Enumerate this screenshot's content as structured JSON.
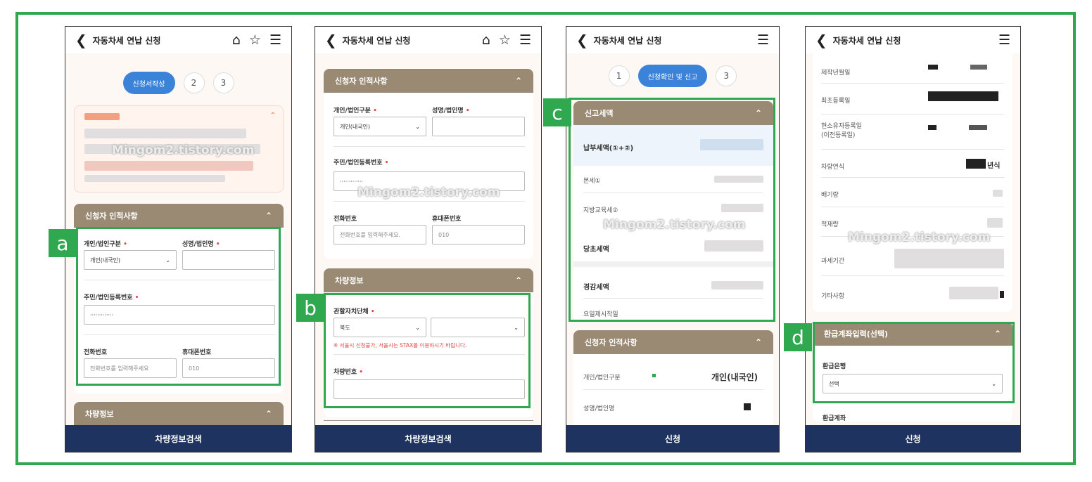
{
  "screens": [
    {
      "header_title": "자동차세 연납 신청",
      "steps": [
        "신청서작성",
        "2",
        "3"
      ],
      "section_applicant": "신청자 인적사항",
      "label_type": "개인/법인구분",
      "label_name": "성명/법인명",
      "select_type_value": "개인(내국인)",
      "label_regno": "주민/법인등록번호",
      "regno_value": "·············",
      "label_phone": "전화번호",
      "phone_placeholder": "전화번호를 입력해주세요",
      "label_mobile": "휴대폰번호",
      "mobile_value": "010",
      "section_vehicle": "차량정보",
      "bottom_button": "차량정보검색",
      "tag": "a"
    },
    {
      "header_title": "자동차세 연납 신청",
      "section_applicant": "신청자 인적사항",
      "label_type": "개인/법인구분",
      "label_name": "성명/법인명",
      "select_type_value": "개인(내국인)",
      "label_regno": "주민/법인등록번호",
      "regno_value": "·············",
      "label_phone": "전화번호",
      "phone_placeholder": "전화번호를 입력해주세요.",
      "label_mobile": "휴대폰번호",
      "mobile_value": "010",
      "section_vehicle": "차량정보",
      "label_region": "관할자치단체",
      "region_value": "북도",
      "region_warning": "※ 서울시 신청불가, 서울시는 STAX를 이용하시기 바랍니다.",
      "label_carno": "차량번호",
      "bottom_button": "차량정보검색",
      "tag": "b"
    },
    {
      "header_title": "자동차세 연납 신청",
      "steps": [
        "1",
        "신청확인 및 신고",
        "3"
      ],
      "section_tax": "신고세액",
      "tax_total": "납부세액(①+②)",
      "tax_main": "본세①",
      "tax_edu": "지방교육세②",
      "tax_initial": "당초세액",
      "tax_reduced": "경감세액",
      "tax_date": "요일제시작일",
      "section_applicant": "신청자 인적사항",
      "label_type": "개인/법인구분",
      "type_value": "개인(내국인)",
      "label_name": "성명/법인명",
      "bottom_button": "신청",
      "tag": "c"
    },
    {
      "header_title": "자동차세 연납 신청",
      "rows": [
        "제작년월일",
        "최초등록일",
        "현소유자등록일\n(이전등록일)",
        "차량연식",
        "배기량",
        "적재량",
        "과세기간",
        "기타사항"
      ],
      "model_year_suffix": "년식",
      "section_refund": "환급계좌입력(선택)",
      "label_bank": "환급은행",
      "bank_value": "선택",
      "label_account": "환급계좌",
      "bottom_button": "신청",
      "tag": "d"
    }
  ],
  "watermark": "Mingom2.tistory.com",
  "colors": {
    "frame": "#2fa84f",
    "section_header": "#9a8a73",
    "bottom_bar": "#1f3361",
    "step_active": "#3b83d9",
    "required": "#e54545"
  }
}
